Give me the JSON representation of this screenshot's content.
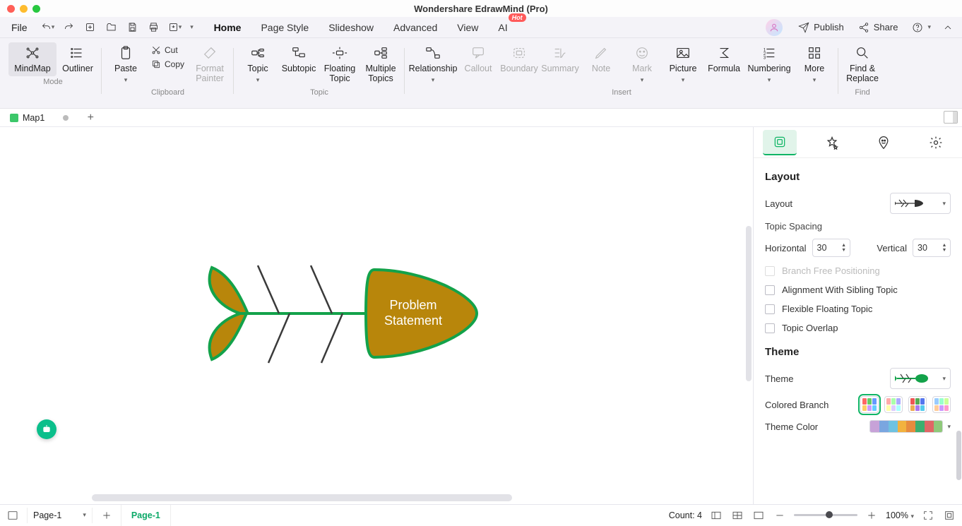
{
  "title": "Wondershare EdrawMind (Pro)",
  "menu": {
    "file": "File",
    "home": "Home",
    "pagestyle": "Page Style",
    "slideshow": "Slideshow",
    "advanced": "Advanced",
    "view": "View",
    "ai": "AI",
    "hot": "Hot"
  },
  "topright": {
    "publish": "Publish",
    "share": "Share"
  },
  "ribbon": {
    "mode": {
      "mindmap": "MindMap",
      "outliner": "Outliner",
      "label": "Mode"
    },
    "clipboard": {
      "paste": "Paste",
      "cut": "Cut",
      "copy": "Copy",
      "fmt": "Format Painter",
      "label": "Clipboard"
    },
    "topic": {
      "topic": "Topic",
      "subtopic": "Subtopic",
      "floating": "Floating Topic",
      "multiple": "Multiple Topics",
      "label": "Topic"
    },
    "insert": {
      "relationship": "Relationship",
      "callout": "Callout",
      "boundary": "Boundary",
      "summary": "Summary",
      "note": "Note",
      "mark": "Mark",
      "picture": "Picture",
      "formula": "Formula",
      "numbering": "Numbering",
      "more": "More",
      "label": "Insert"
    },
    "find": {
      "findreplace": "Find & Replace",
      "label": "Find"
    }
  },
  "doc": {
    "tab": "Map1"
  },
  "canvas": {
    "centralTopic1": "Problem",
    "centralTopic2": "Statement"
  },
  "side": {
    "layout_h": "Layout",
    "layout_l": "Layout",
    "spacing": "Topic Spacing",
    "horiz": "Horizontal",
    "horiz_v": "30",
    "vert": "Vertical",
    "vert_v": "30",
    "branch": "Branch Free Positioning",
    "align": "Alignment With Sibling Topic",
    "flex": "Flexible Floating Topic",
    "overlap": "Topic Overlap",
    "theme_h": "Theme",
    "theme_l": "Theme",
    "colored": "Colored Branch",
    "themecolor": "Theme Color"
  },
  "status": {
    "page_dd": "Page-1",
    "page_tab": "Page-1",
    "count": "Count: 4",
    "zoom": "100%"
  }
}
